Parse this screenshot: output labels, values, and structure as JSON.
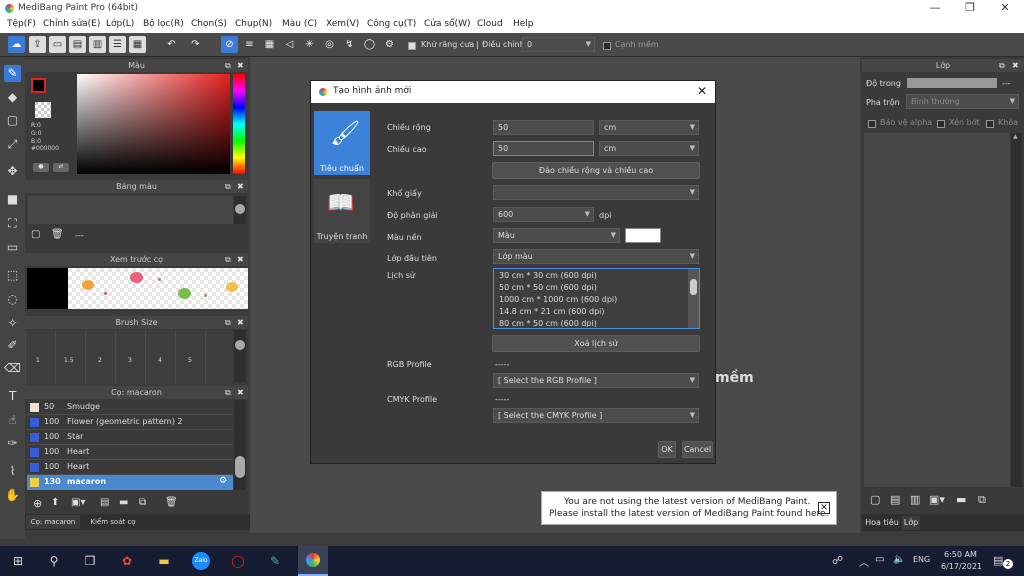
{
  "app": {
    "title": "MediBang Paint Pro (64bit)"
  },
  "window_controls": {
    "minimize": "—",
    "maximize": "❐",
    "close": "✕"
  },
  "menu": [
    "Tệp(F)",
    "Chỉnh sửa(E)",
    "Lớp(L)",
    "Bộ lọc(R)",
    "Chọn(S)",
    "Chụp(N)",
    "Màu (C)",
    "Xem(V)",
    "Công cụ(T)",
    "Cửa sổ(W)",
    "Cloud",
    "Help"
  ],
  "toolbar": {
    "antialias_label": "Khử răng cưa",
    "adjust_label": "Điều chỉnh",
    "adjust_value": "0",
    "edge_label": "Cạnh mềm"
  },
  "color_panel": {
    "title": "Màu",
    "r": "R:0",
    "g": "G:0",
    "b": "B:0",
    "hex": "#000000",
    "primary_color": "#000000",
    "secondary_color": "#ffffff"
  },
  "palette_panel": {
    "title": "Bảng màu",
    "value": "---"
  },
  "brush_preview_panel": {
    "title": "Xem trước cọ"
  },
  "brush_size_panel": {
    "title": "Brush Size",
    "sizes": [
      "1",
      "1.5",
      "2",
      "3",
      "4",
      "5"
    ]
  },
  "brush_list_panel": {
    "title": "Cọ: macaron",
    "items": [
      {
        "size": "50",
        "name": "Smudge",
        "color": "#f0e0d0"
      },
      {
        "size": "100",
        "name": "Flower (geometric pattern) 2",
        "color": "#3a5bd8"
      },
      {
        "size": "100",
        "name": "Star",
        "color": "#3a5bd8"
      },
      {
        "size": "100",
        "name": "Heart",
        "color": "#3a5bd8"
      },
      {
        "size": "100",
        "name": "Heart",
        "color": "#3a5bd8"
      },
      {
        "size": "130",
        "name": "macaron",
        "color": "#f0d040",
        "selected": true
      }
    ],
    "tab_brush": "Cọ: macaron",
    "tab_control": "Kiểm soát cọ"
  },
  "canvas": {
    "partial_text": "mềm"
  },
  "dialog": {
    "title": "Tạo hình ảnh mới",
    "close": "✕",
    "side_tabs": [
      {
        "label": "Tiêu chuẩn"
      },
      {
        "label": "Truyện tranh"
      }
    ],
    "width_label": "Chiều rộng",
    "width_value": "50",
    "width_unit": "cm",
    "height_label": "Chiều cao",
    "height_value": "50",
    "height_unit": "cm",
    "swap_button": "Đảo chiều rộng và chiều cao",
    "paper_label": "Khổ giấy",
    "paper_value": "",
    "dpi_label": "Độ phân giải",
    "dpi_value": "600",
    "dpi_unit": "dpi",
    "bg_label": "Màu nền",
    "bg_value": "Màu",
    "bg_color": "#ffffff",
    "first_layer_label": "Lớp đầu tiên",
    "first_layer_value": "Lớp màu",
    "history_label": "Lịch sử",
    "history": [
      "30 cm * 30 cm (600 dpi)",
      "50 cm * 50 cm (600 dpi)",
      "1000 cm * 1000 cm (600 dpi)",
      "14.8 cm * 21 cm (600 dpi)",
      "80 cm * 50 cm (600 dpi)"
    ],
    "clear_history_button": "Xoá lịch sử",
    "rgb_label": "RGB Profile",
    "rgb_value": "-----",
    "rgb_select": "[ Select the RGB Profile ]",
    "cmyk_label": "CMYK Profile",
    "cmyk_value": "-----",
    "cmyk_select": "[ Select the CMYK Profile ]",
    "ok_button": "OK",
    "cancel_button": "Cancel"
  },
  "right_panel": {
    "title": "Lớp",
    "opacity_label": "Độ trong",
    "opacity_value": "---",
    "blend_label": "Pha trộn",
    "blend_value": "Bình thường",
    "protect_alpha": "Bảo vệ alpha",
    "clipping": "Xén bớt",
    "lock": "Khóa",
    "tab_hoatieu": "Hoa tiêu",
    "tab_lop": "Lớp"
  },
  "notification": {
    "line1": "You are not using the latest version of MediBang Paint.",
    "line2": "Please install the latest version of MediBang Paint found here.",
    "close": "✕"
  },
  "taskbar": {
    "time": "6:50 AM",
    "date": "6/17/2021",
    "lang": "ENG",
    "notif_count": "2"
  }
}
